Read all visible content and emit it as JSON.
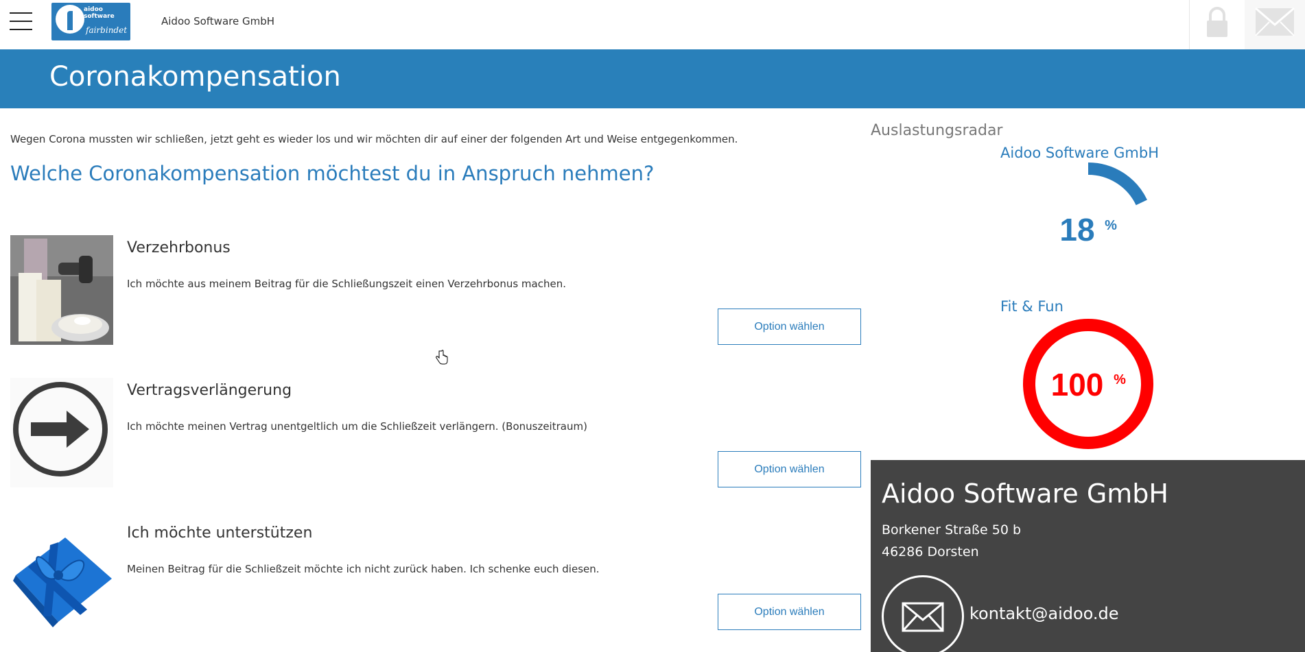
{
  "topbar": {
    "menu_icon": "hamburger-menu-icon",
    "logo": {
      "line1": "aidoo",
      "line2": "software",
      "line3": "fairbindet"
    },
    "company": "Aidoo Software GmbH",
    "lock_icon": "lock-icon",
    "mail_icon": "envelope-icon"
  },
  "header": {
    "title": "Coronakompensation"
  },
  "main": {
    "intro": "Wegen Corona mussten wir schließen, jetzt geht es wieder los und wir möchten dir auf einer der folgenden Art und Weise entgegenkommen.",
    "question": "Welche Coronakompensation möchtest du in Anspruch nehmen?",
    "options": [
      {
        "title": "Verzehrbonus",
        "description": "Ich möchte aus meinem Beitrag für die Schließungszeit einen Verzehrbonus machen.",
        "button": "Option wählen",
        "image": "drinks-image"
      },
      {
        "title": "Vertragsverlängerung",
        "description": "Ich möchte meinen Vertrag unentgeltlich um die Schließzeit verlängern. (Bonuszeitraum)",
        "button": "Option wählen",
        "image": "arrow-circle-icon"
      },
      {
        "title": "Ich möchte unterstützen",
        "description": "Meinen Beitrag für die Schließzeit möchte ich nicht zurück haben. Ich schenke euch diesen.",
        "button": "Option wählen",
        "image": "gift-image"
      }
    ]
  },
  "sidebar": {
    "radar_title": "Auslastungsradar",
    "gyms": [
      {
        "name": "Aidoo Software GmbH",
        "value": "18",
        "percent": 18,
        "unit": "%",
        "color": "#2a7cbb"
      },
      {
        "name": "Fit & Fun",
        "value": "100",
        "percent": 100,
        "unit": "%",
        "color": "#ff0000"
      }
    ],
    "contact": {
      "name": "Aidoo Software GmbH",
      "street": "Borkener Straße 50 b",
      "city": "46286 Dorsten",
      "email": "kontakt@aidoo.de"
    }
  },
  "colors": {
    "accent": "#2980ba",
    "contact_bg": "#444444"
  }
}
